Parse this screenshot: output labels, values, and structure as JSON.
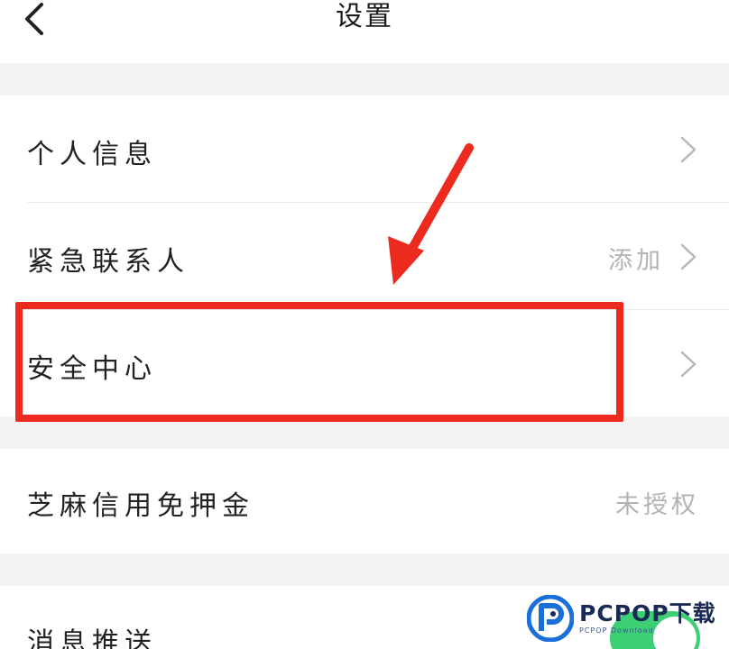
{
  "header": {
    "title": "设置",
    "back_icon": "chevron-left-icon"
  },
  "settings": {
    "personal_info": {
      "label": "个人信息"
    },
    "emergency_contact": {
      "label": "紧急联系人",
      "value": "添加"
    },
    "security_center": {
      "label": "安全中心"
    },
    "zhima_credit": {
      "label": "芝麻信用免押金",
      "value": "未授权"
    },
    "push_messages": {
      "label": "消息推送",
      "toggle_on": true
    }
  },
  "annotation": {
    "color": "#ec2a1e"
  },
  "watermark": {
    "main": "PCPOP下载",
    "sub": "PCPOP Download"
  },
  "colors": {
    "background_gap": "#f3f3f5",
    "secondary_text": "#b3b3b3",
    "toggle_on": "#3ccf73"
  }
}
